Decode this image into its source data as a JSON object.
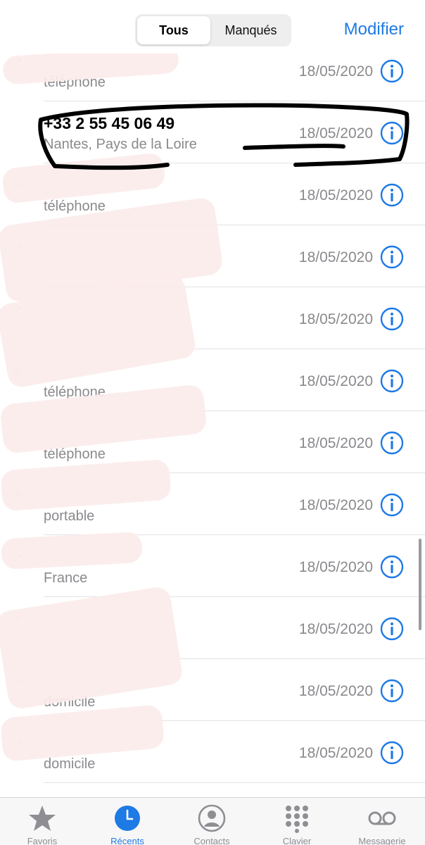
{
  "header": {
    "segments": [
      "Tous",
      "Manqués"
    ],
    "edit_label": "Modifier"
  },
  "calls": [
    {
      "name": "",
      "subtitle": "téléphone",
      "date": "18/05/2020"
    },
    {
      "name": "+33 2 55 45 06 49",
      "subtitle": "Nantes, Pays de la Loire",
      "date": "18/05/2020"
    },
    {
      "name": "",
      "subtitle": "téléphone",
      "date": "18/05/2020"
    },
    {
      "name": "",
      "subtitle": "",
      "date": "18/05/2020"
    },
    {
      "name": "",
      "subtitle": "",
      "date": "18/05/2020"
    },
    {
      "name": "",
      "subtitle": "téléphone",
      "date": "18/05/2020"
    },
    {
      "name": "",
      "subtitle": "téléphone",
      "date": "18/05/2020"
    },
    {
      "name": "",
      "subtitle": "portable",
      "date": "18/05/2020"
    },
    {
      "name": "",
      "subtitle": "France",
      "date": "18/05/2020"
    },
    {
      "name": "",
      "subtitle": "",
      "date": "18/05/2020"
    },
    {
      "name": "",
      "subtitle": "domicile",
      "date": "18/05/2020"
    },
    {
      "name": "",
      "subtitle": "domicile",
      "date": "18/05/2020"
    }
  ],
  "tabs": [
    {
      "label": "Favoris",
      "icon": "star-icon",
      "active": false
    },
    {
      "label": "Récents",
      "icon": "clock-icon",
      "active": true
    },
    {
      "label": "Contacts",
      "icon": "contact-icon",
      "active": false
    },
    {
      "label": "Clavier",
      "icon": "keypad-icon",
      "active": false
    },
    {
      "label": "Messagerie",
      "icon": "voicemail-icon",
      "active": false
    }
  ],
  "colors": {
    "accent": "#1e7ae4",
    "secondary_text": "#8a8a8e",
    "separator": "#e2e2e6"
  }
}
